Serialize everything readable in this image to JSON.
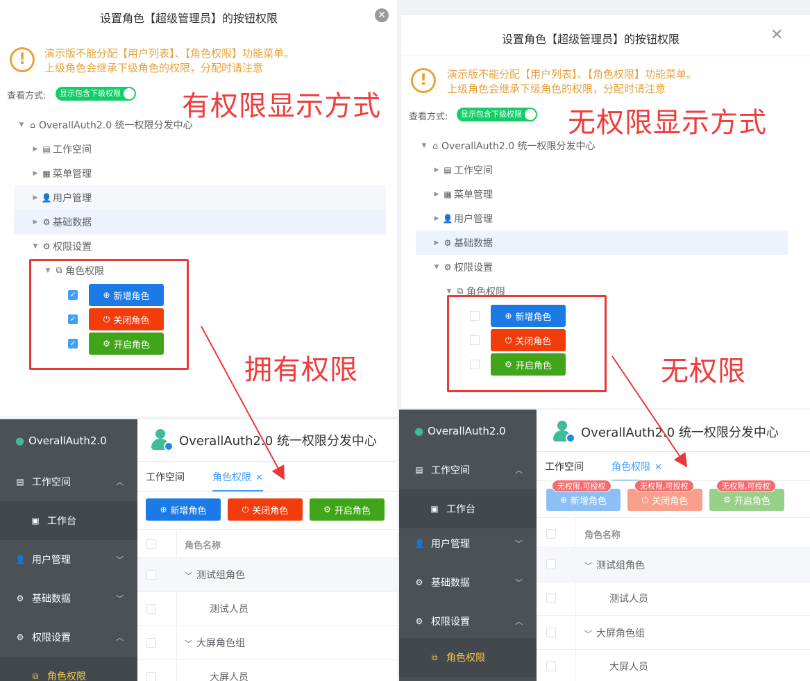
{
  "left_dialog": {
    "title": "设置角色【超级管理员】的按钮权限",
    "close_glyph": "✕",
    "warning_line1": "演示版不能分配【用户列表】、【角色权限】功能菜单。",
    "warning_line2": "上级角色会继承下级角色的权限，分配时请注意",
    "warning_glyph": "!",
    "view_label": "查看方式:",
    "switch_label": "显示包含下级权限",
    "annotation": "有权限显示方式",
    "tree": {
      "root": "OverallAuth2.0 统一权限分发中心",
      "items": [
        "工作空间",
        "菜单管理",
        "用户管理",
        "基础数据",
        "权限设置"
      ],
      "sub": "角色权限"
    },
    "buttons": [
      {
        "label": "新增角色",
        "icon": "⊕",
        "checked": true
      },
      {
        "label": "关闭角色",
        "icon": "⏻",
        "checked": true
      },
      {
        "label": "开启角色",
        "icon": "⚙",
        "checked": true
      }
    ],
    "callout": "拥有权限"
  },
  "right_dialog": {
    "title": "设置角色【超级管理员】的按钮权限",
    "close_glyph": "✕",
    "warning_line1": "演示版不能分配【用户列表】、【角色权限】功能菜单。",
    "warning_line2": "上级角色会继承下级角色的权限，分配时请注意",
    "warning_glyph": "!",
    "view_label": "查看方式:",
    "switch_label": "显示包含下级权限",
    "annotation": "无权限显示方式",
    "tree": {
      "root": "OverallAuth2.0 统一权限分发中心",
      "items": [
        "工作空间",
        "菜单管理",
        "用户管理",
        "基础数据",
        "权限设置"
      ],
      "sub": "角色权限"
    },
    "buttons": [
      {
        "label": "新增角色",
        "icon": "⊕",
        "checked": false
      },
      {
        "label": "关闭角色",
        "icon": "⏻",
        "checked": false
      },
      {
        "label": "开启角色",
        "icon": "⚙",
        "checked": false
      }
    ],
    "callout": "无权限"
  },
  "left_app": {
    "brand": "OverallAuth2.0",
    "header": "OverallAuth2.0 统一权限分发中心",
    "menu": [
      {
        "label": "工作空间",
        "icon": "▤",
        "chevron": "︿"
      },
      {
        "label": "工作台",
        "icon": "▣",
        "sub": true
      },
      {
        "label": "用户管理",
        "icon": "👤",
        "chevron": "﹀"
      },
      {
        "label": "基础数据",
        "icon": "⚙",
        "chevron": "﹀"
      },
      {
        "label": "权限设置",
        "icon": "⚙",
        "chevron": "︿"
      },
      {
        "label": "角色权限",
        "icon": "⧉",
        "active": true
      }
    ],
    "tabs": [
      {
        "label": "工作空间"
      },
      {
        "label": "角色权限",
        "close": "✕"
      }
    ],
    "buttons": [
      "新增角色",
      "关闭角色",
      "开启角色"
    ],
    "table_header": "角色名称",
    "rows": [
      {
        "label": "测试组角色",
        "expand": "﹀"
      },
      {
        "label": "测试人员"
      },
      {
        "label": "大屏角色组",
        "expand": "﹀"
      },
      {
        "label": "大屏人员"
      }
    ]
  },
  "right_app": {
    "brand": "OverallAuth2.0",
    "header": "OverallAuth2.0 统一权限分发中心",
    "menu": [
      {
        "label": "工作空间",
        "icon": "▤",
        "chevron": "︿"
      },
      {
        "label": "工作台",
        "icon": "▣",
        "sub": true
      },
      {
        "label": "用户管理",
        "icon": "👤",
        "chevron": "﹀"
      },
      {
        "label": "基础数据",
        "icon": "⚙",
        "chevron": "﹀"
      },
      {
        "label": "权限设置",
        "icon": "⚙",
        "chevron": "︿"
      },
      {
        "label": "角色权限",
        "icon": "⧉",
        "active": true
      }
    ],
    "tabs": [
      {
        "label": "工作空间"
      },
      {
        "label": "角色权限",
        "close": "✕"
      }
    ],
    "buttons": [
      "新增角色",
      "关闭角色",
      "开启角色"
    ],
    "badge": "无权限,可授权",
    "table_header": "角色名称",
    "rows": [
      {
        "label": "测试组角色",
        "expand": "﹀"
      },
      {
        "label": "测试人员"
      },
      {
        "label": "大屏角色组",
        "expand": "﹀"
      },
      {
        "label": "大屏人员"
      }
    ]
  },
  "colors": {
    "primary": "#1c7ae6",
    "danger": "#f23c0c",
    "success": "#41a51a",
    "warning": "#e6a23c",
    "annotation_red": "#f03c3c",
    "sidebar": "#4b5154"
  }
}
